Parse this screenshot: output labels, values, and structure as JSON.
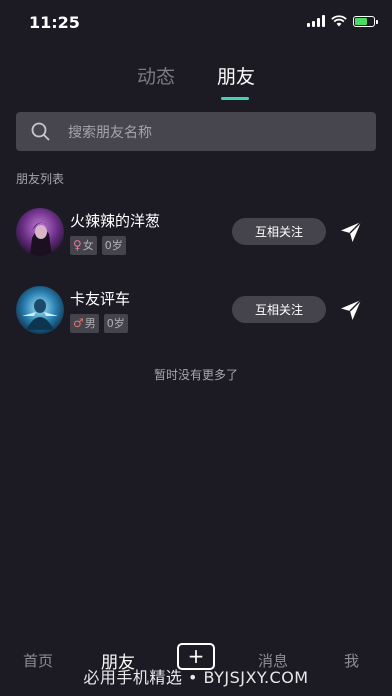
{
  "status_bar": {
    "time": "11:25"
  },
  "tabs": [
    {
      "label": "动态",
      "active": false
    },
    {
      "label": "朋友",
      "active": true
    }
  ],
  "search": {
    "placeholder": "搜索朋友名称"
  },
  "section_title": "朋友列表",
  "friends": [
    {
      "name": "火辣辣的洋葱",
      "gender_symbol": "♀",
      "gender": "女",
      "age": "0岁",
      "action": "互相关注"
    },
    {
      "name": "卡友评车",
      "gender_symbol": "♂",
      "gender": "男",
      "age": "0岁",
      "action": "互相关注"
    }
  ],
  "no_more_text": "暂时没有更多了",
  "bottom_nav": {
    "home": "首页",
    "friends": "朋友",
    "add": "+",
    "messages": "消息",
    "me": "我"
  },
  "watermark": "必用手机精选 • BYJSJXY.COM",
  "colors": {
    "accent": "#3fd4b6",
    "background": "#1c1b24"
  }
}
